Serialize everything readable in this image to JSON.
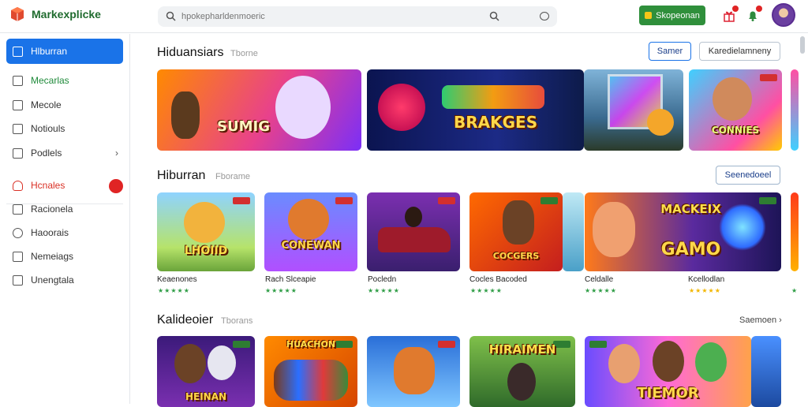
{
  "header": {
    "app_name": "Markexplicke",
    "search_placeholder": "hpokepharldenmoeric",
    "cta_label": "Skopeonan"
  },
  "sidebar": {
    "items": [
      {
        "label": "Hlburran",
        "icon": "store-icon",
        "active": true
      },
      {
        "label": "Mecarlas",
        "icon": "home-icon"
      },
      {
        "label": "Mecole",
        "icon": "window-icon"
      },
      {
        "label": "Notiouls",
        "icon": "calendar-icon"
      },
      {
        "label": "Podlels",
        "icon": "puzzle-icon"
      },
      {
        "label": "Hcnales",
        "icon": "fire-icon"
      },
      {
        "label": "Racionela",
        "icon": "folder-icon"
      },
      {
        "label": "Haoorais",
        "icon": "shield-icon"
      },
      {
        "label": "Nemeiags",
        "icon": "tag-icon"
      },
      {
        "label": "Unengtala",
        "icon": "document-icon"
      }
    ]
  },
  "sections": [
    {
      "title": "Hiduansiars",
      "subtitle": "Tborne",
      "buttons": [
        "Samer",
        "Karedielamneny"
      ]
    },
    {
      "title": "Hiburran",
      "subtitle": "Fborame",
      "buttons": [
        "Seenedoeel"
      ]
    },
    {
      "title": "Kalideoier",
      "subtitle": "Tborans",
      "link": "Saemoen"
    }
  ],
  "featured": [
    {
      "banner": "SUMIG"
    },
    {
      "banner": "BRAKGES"
    },
    {
      "banner": ""
    },
    {
      "banner": "CONNIES"
    }
  ],
  "cards_row2": [
    {
      "title": "Keaenones",
      "banner": "LHOIID"
    },
    {
      "title": "Rach Slceapie",
      "banner": "CONEWAN"
    },
    {
      "title": "Pocledn",
      "banner": ""
    },
    {
      "title": "Cocles Bacoded",
      "banner": "COCGERS"
    },
    {
      "title": "Celdalle",
      "banner": "GAMO"
    },
    {
      "title": "Kcellodlan",
      "banner": "MACKEIX"
    }
  ],
  "cards_row3": [
    {
      "banner": "HEINAN"
    },
    {
      "banner": "HUACHON"
    },
    {
      "banner": ""
    },
    {
      "banner": "HIRAIMEN"
    },
    {
      "banner": "TIEMOR"
    }
  ],
  "colors": {
    "accent": "#1a73e8",
    "cta": "#2f8f3b",
    "brand": "#1f6b2e",
    "rating_green": "#2e9d45",
    "rating_gold": "#f2b600"
  }
}
